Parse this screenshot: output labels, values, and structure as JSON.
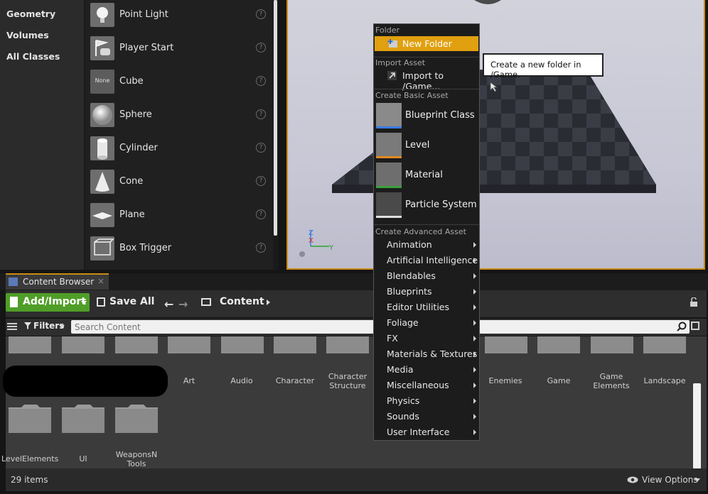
{
  "class_panel": {
    "categories": [
      "Geometry",
      "Volumes",
      "All Classes"
    ]
  },
  "asset_panel": {
    "items": [
      {
        "name": "Point Light",
        "icon": "lightbulb-icon"
      },
      {
        "name": "Player Start",
        "icon": "player-start-icon"
      },
      {
        "name": "Cube",
        "icon": "cube-icon",
        "thumb_text": "None"
      },
      {
        "name": "Sphere",
        "icon": "sphere-icon"
      },
      {
        "name": "Cylinder",
        "icon": "cylinder-icon"
      },
      {
        "name": "Cone",
        "icon": "cone-icon"
      },
      {
        "name": "Plane",
        "icon": "plane-icon"
      },
      {
        "name": "Box Trigger",
        "icon": "box-trigger-icon"
      }
    ],
    "help_glyph": "?"
  },
  "viewport": {
    "axis_z": "Z",
    "axis_x": "X",
    "axis_y": "Y"
  },
  "context_menu": {
    "sections": {
      "folder": "Folder",
      "import": "Import Asset",
      "basic": "Create Basic Asset",
      "advanced": "Create Advanced Asset"
    },
    "new_folder": "New Folder",
    "import_item": "Import to /Game...",
    "basic_assets": [
      "Blueprint Class",
      "Level",
      "Material",
      "Particle System"
    ],
    "advanced_assets": [
      "Animation",
      "Artificial Intelligence",
      "Blendables",
      "Blueprints",
      "Editor Utilities",
      "Foliage",
      "FX",
      "Materials & Textures",
      "Media",
      "Miscellaneous",
      "Physics",
      "Sounds",
      "User Interface"
    ]
  },
  "tooltip": {
    "text": "Create a new folder in /Game."
  },
  "content_browser": {
    "tab_label": "Content Browser",
    "tab_close": "×",
    "add_import": "Add/Import",
    "save_all": "Save All",
    "path": "Content",
    "filters": "Filters",
    "search_placeholder": "Search Content",
    "folders_row1": [
      {
        "label": "Art"
      },
      {
        "label": "Audio"
      },
      {
        "label": "Character"
      },
      {
        "label": "Character Structure"
      },
      {
        "label": "Enemies"
      },
      {
        "label": "Game"
      },
      {
        "label": "Game Elements"
      },
      {
        "label": "Landscape"
      }
    ],
    "folders_row2": [
      {
        "label": "LevelElements"
      },
      {
        "label": "UI"
      },
      {
        "label": "WeaponsN Tools"
      }
    ],
    "item_count": "29 items",
    "view_options": "View Options"
  },
  "colors": {
    "accent": "#c98b10",
    "add_button": "#4f9e28",
    "menu_highlight": "#e0a010"
  }
}
